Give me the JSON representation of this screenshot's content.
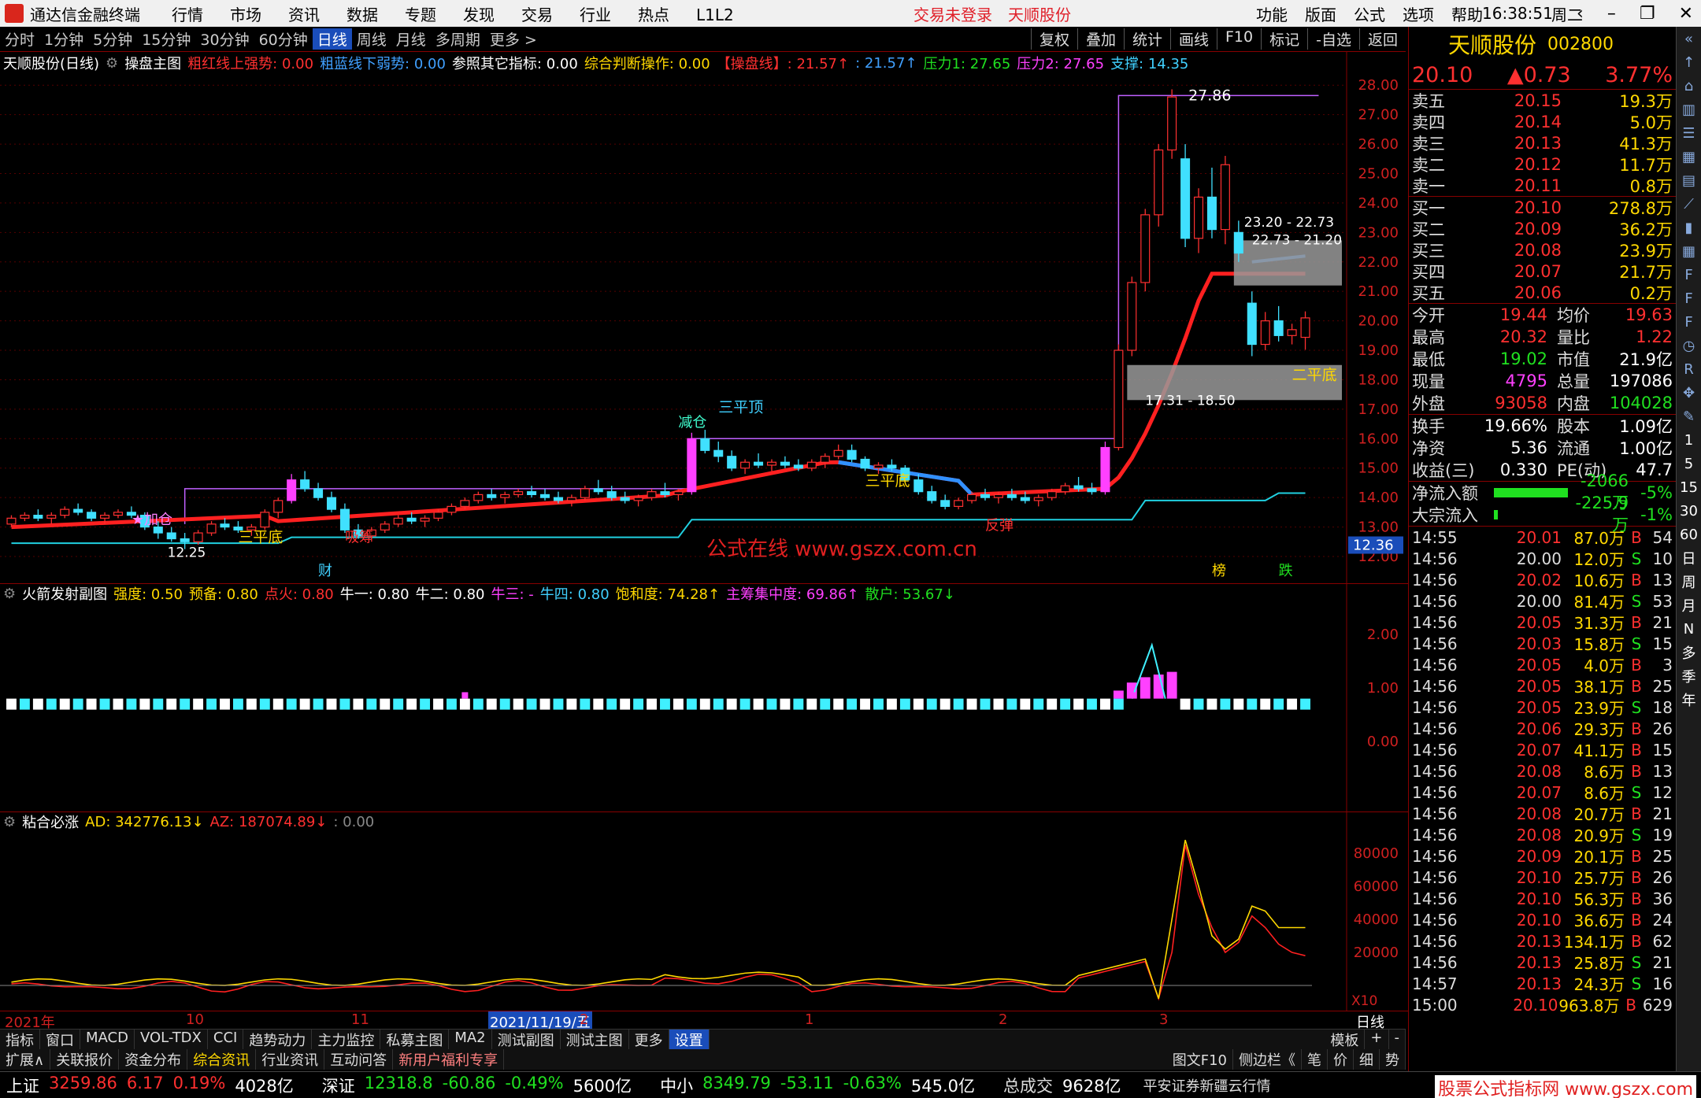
{
  "titlebar": {
    "app_name": "通达信金融终端",
    "menu": [
      "行情",
      "市场",
      "资讯",
      "数据",
      "专题",
      "发现",
      "交易",
      "行业",
      "热点",
      "L1L2"
    ],
    "login_status": "交易未登录",
    "stock_name": "天顺股份",
    "right_menu": [
      "功能",
      "版面",
      "公式",
      "选项",
      "帮助"
    ],
    "clock": "16:38:51",
    "weekday": "周二"
  },
  "periods": [
    "分时",
    "1分钟",
    "5分钟",
    "15分钟",
    "30分钟",
    "60分钟",
    "日线",
    "周线",
    "月线",
    "多周期",
    "更多 >"
  ],
  "active_period": "日线",
  "tools": [
    "复权",
    "叠加",
    "统计",
    "画线",
    "F10",
    "标记",
    "-自选",
    "返回"
  ],
  "main_chart": {
    "stock_label": "天顺股份(日线)",
    "indicator_name": "操盘主图",
    "readouts": [
      {
        "text": "粗红线上强势: 0.00",
        "color": "#ff3030"
      },
      {
        "text": "粗蓝线下弱势: 0.00",
        "color": "#40a0ff"
      },
      {
        "text": "参照其它指标: 0.00",
        "color": "#ffffff"
      },
      {
        "text": "综合判断操作: 0.00",
        "color": "#ffd800"
      },
      {
        "text": "【操盘线】: 21.57↑",
        "color": "#ff3030"
      },
      {
        "text": ": 21.57↑",
        "color": "#40a0ff"
      },
      {
        "text": "压力1: 27.65",
        "color": "#20e020"
      },
      {
        "text": "压力2: 27.65",
        "color": "#ff40ff"
      },
      {
        "text": "支撑: 14.35",
        "color": "#40d0ff"
      }
    ],
    "y_ticks": [
      "28.00",
      "27.00",
      "26.00",
      "25.00",
      "24.00",
      "23.00",
      "22.00",
      "21.00",
      "20.00",
      "19.00",
      "18.00",
      "17.00",
      "16.00",
      "15.00",
      "14.00",
      "13.00",
      "12.00"
    ],
    "current_price_tag": "12.36",
    "annotations": {
      "high": "27.86",
      "zone1": "23.20 - 22.73",
      "zone1b": "22.73 - 21.20",
      "zone2": "17.31 - 18.50",
      "low": "12.25",
      "sanpingding": "三平顶",
      "sanpingdi_1": "三平底",
      "sanpingdi_2": "三平底",
      "sanpingdi_3": "二平底",
      "jiacang": "★加仓",
      "jiancang": "减仓",
      "fantan": "反弹",
      "xichou": "吸筹",
      "watermark": "公式在线  www.gszx.com.cn",
      "cai": "财",
      "bang": "榜",
      "die": "跌"
    }
  },
  "sub1": {
    "name": "火箭发射副图",
    "readouts": [
      {
        "text": "强度: 0.50",
        "color": "#ffd800"
      },
      {
        "text": "预备: 0.80",
        "color": "#ffd800"
      },
      {
        "text": "点火: 0.80",
        "color": "#ff3030"
      },
      {
        "text": "牛一: 0.80",
        "color": "#ffffff"
      },
      {
        "text": "牛二: 0.80",
        "color": "#ffffff"
      },
      {
        "text": "牛三: -",
        "color": "#ff40ff"
      },
      {
        "text": "牛四: 0.80",
        "color": "#40d0ff"
      },
      {
        "text": "饱和度: 74.28↑",
        "color": "#ffd800"
      },
      {
        "text": "主筹集中度: 69.86↑",
        "color": "#ff40ff"
      },
      {
        "text": "散户: 53.67↓",
        "color": "#20e020"
      }
    ],
    "y_ticks": [
      "2.00",
      "1.00",
      "0.00"
    ]
  },
  "sub2": {
    "name": "粘合必涨",
    "readouts": [
      {
        "text": "AD: 342776.13↓",
        "color": "#ffd800"
      },
      {
        "text": "AZ: 187074.89↓",
        "color": "#ff3030"
      },
      {
        "text": ": 0.00",
        "color": "#888888"
      }
    ],
    "y_ticks": [
      "80000",
      "60000",
      "40000",
      "20000"
    ],
    "x10": "X10"
  },
  "x_axis": {
    "labels": [
      "2021年",
      "10",
      "11",
      "2021/11/19/五",
      "2",
      "1",
      "2",
      "3"
    ],
    "right_label": "日线"
  },
  "bottom_tabs": [
    "指标",
    "窗口",
    "MACD",
    "VOL-TDX",
    "CCI",
    "趋势动力",
    "主力监控",
    "私募主图",
    "MA2",
    "测试副图",
    "测试主图",
    "更多",
    "设置"
  ],
  "bottom_right": [
    "模板",
    "+",
    "-"
  ],
  "sub_tabs": [
    "扩展∧",
    "关联报价",
    "资金分布",
    "综合资讯",
    "行业资讯",
    "互动问答",
    "新用户福利专享"
  ],
  "sub_tabs_right": [
    "图文F10",
    "侧边栏《",
    "笔",
    "价",
    "细",
    "势"
  ],
  "status": [
    {
      "name": "上证",
      "value": "3259.86",
      "chg": "6.17",
      "pct": "0.19%",
      "amt": "4028亿",
      "color": "#ff3030"
    },
    {
      "name": "深证",
      "value": "12318.8",
      "chg": "-60.86",
      "pct": "-0.49%",
      "amt": "5600亿",
      "color": "#20e020"
    },
    {
      "name": "中小",
      "value": "8349.79",
      "chg": "-53.11",
      "pct": "-0.63%",
      "amt": "545.0亿",
      "color": "#20e020"
    }
  ],
  "status_total": {
    "label": "总成交",
    "value": "9628亿"
  },
  "status_broker": "平安证券新疆云行情",
  "brand_watermark": "股票公式指标网  www.gszx.com",
  "quote": {
    "name": "天顺股份",
    "code": "002800",
    "price": "20.10",
    "change": "▲0.73",
    "pct": "3.77%",
    "asks": [
      {
        "label": "卖五",
        "price": "20.15",
        "vol": "19.3万"
      },
      {
        "label": "卖四",
        "price": "20.14",
        "vol": "5.0万"
      },
      {
        "label": "卖三",
        "price": "20.13",
        "vol": "41.3万"
      },
      {
        "label": "卖二",
        "price": "20.12",
        "vol": "11.7万"
      },
      {
        "label": "卖一",
        "price": "20.11",
        "vol": "0.8万"
      }
    ],
    "bids": [
      {
        "label": "买一",
        "price": "20.10",
        "vol": "278.8万"
      },
      {
        "label": "买二",
        "price": "20.09",
        "vol": "36.2万"
      },
      {
        "label": "买三",
        "price": "20.08",
        "vol": "23.9万"
      },
      {
        "label": "买四",
        "price": "20.07",
        "vol": "21.7万"
      },
      {
        "label": "买五",
        "price": "20.06",
        "vol": "0.2万"
      }
    ],
    "stats1": [
      {
        "a": "今开",
        "b": "19.44",
        "bc": "#ff3030",
        "c": "均价",
        "d": "19.63",
        "dc": "#ff3030"
      },
      {
        "a": "最高",
        "b": "20.32",
        "bc": "#ff3030",
        "c": "量比",
        "d": "1.22",
        "dc": "#ff3030"
      },
      {
        "a": "最低",
        "b": "19.02",
        "bc": "#20e020",
        "c": "市值",
        "d": "21.9亿",
        "dc": "#ffffff"
      },
      {
        "a": "现量",
        "b": "4795",
        "bc": "#ff40ff",
        "c": "总量",
        "d": "197086",
        "dc": "#ffffff"
      },
      {
        "a": "外盘",
        "b": "93058",
        "bc": "#ff3030",
        "c": "内盘",
        "d": "104028",
        "dc": "#20e020"
      }
    ],
    "stats2": [
      {
        "a": "换手",
        "b": "19.66%",
        "bc": "#ffffff",
        "c": "股本",
        "d": "1.09亿",
        "dc": "#ffffff"
      },
      {
        "a": "净资",
        "b": "5.36",
        "bc": "#ffffff",
        "c": "流通",
        "d": "1.00亿",
        "dc": "#ffffff"
      },
      {
        "a": "收益(三)",
        "b": "0.330",
        "bc": "#ffffff",
        "c": "PE(动)",
        "d": "47.7",
        "dc": "#ffffff"
      }
    ],
    "flows": [
      {
        "label": "净流入额",
        "value": "-2066万",
        "pct": "-5%",
        "bar": 0.9
      },
      {
        "label": "大宗流入",
        "value": "-225.9万",
        "pct": "-1%",
        "bar": 0.05
      }
    ],
    "ticks": [
      [
        "14:55",
        "20.01",
        "87.0万",
        "B",
        "54"
      ],
      [
        "14:56",
        "20.00",
        "12.0万",
        "S",
        "10"
      ],
      [
        "14:56",
        "20.02",
        "10.6万",
        "B",
        "13"
      ],
      [
        "14:56",
        "20.00",
        "81.4万",
        "S",
        "53"
      ],
      [
        "14:56",
        "20.05",
        "31.3万",
        "B",
        "21"
      ],
      [
        "14:56",
        "20.03",
        "15.8万",
        "S",
        "15"
      ],
      [
        "14:56",
        "20.05",
        "4.0万",
        "B",
        "3"
      ],
      [
        "14:56",
        "20.05",
        "38.1万",
        "B",
        "25"
      ],
      [
        "14:56",
        "20.05",
        "23.9万",
        "S",
        "18"
      ],
      [
        "14:56",
        "20.06",
        "29.3万",
        "B",
        "26"
      ],
      [
        "14:56",
        "20.07",
        "41.1万",
        "B",
        "15"
      ],
      [
        "14:56",
        "20.08",
        "8.6万",
        "B",
        "13"
      ],
      [
        "14:56",
        "20.07",
        "8.6万",
        "S",
        "12"
      ],
      [
        "14:56",
        "20.08",
        "20.7万",
        "B",
        "21"
      ],
      [
        "14:56",
        "20.08",
        "20.9万",
        "S",
        "19"
      ],
      [
        "14:56",
        "20.09",
        "20.1万",
        "B",
        "25"
      ],
      [
        "14:56",
        "20.10",
        "25.7万",
        "B",
        "26"
      ],
      [
        "14:56",
        "20.10",
        "56.3万",
        "B",
        "36"
      ],
      [
        "14:56",
        "20.10",
        "36.6万",
        "B",
        "24"
      ],
      [
        "14:56",
        "20.13",
        "134.1万",
        "B",
        "62"
      ],
      [
        "14:56",
        "20.13",
        "25.8万",
        "S",
        "21"
      ],
      [
        "14:57",
        "20.13",
        "24.3万",
        "S",
        "16"
      ],
      [
        "15:00",
        "20.10",
        "963.8万",
        "B",
        "629"
      ]
    ]
  },
  "sidebar_labels": [
    "1",
    "5",
    "15",
    "30",
    "60",
    "日",
    "周",
    "月",
    "N",
    "多",
    "季",
    "年"
  ],
  "colors": {
    "up": "#ff3030",
    "down": "#40d0ff",
    "accent": "#1a4dba",
    "border": "#880000"
  },
  "chart_data": {
    "type": "candlestick",
    "title": "天顺股份(日线)",
    "ylim": [
      12.0,
      28.0
    ],
    "candles": [
      [
        13.1,
        13.4,
        13.0,
        13.3
      ],
      [
        13.3,
        13.5,
        13.2,
        13.4
      ],
      [
        13.4,
        13.6,
        13.2,
        13.3
      ],
      [
        13.3,
        13.5,
        13.1,
        13.4
      ],
      [
        13.4,
        13.7,
        13.3,
        13.6
      ],
      [
        13.6,
        13.8,
        13.4,
        13.5
      ],
      [
        13.5,
        13.6,
        13.2,
        13.3
      ],
      [
        13.3,
        13.5,
        13.1,
        13.4
      ],
      [
        13.4,
        13.6,
        13.3,
        13.5
      ],
      [
        13.5,
        13.7,
        13.3,
        13.4
      ],
      [
        13.4,
        13.5,
        12.9,
        13.0
      ],
      [
        13.0,
        13.2,
        12.6,
        12.8
      ],
      [
        12.8,
        13.0,
        12.5,
        12.6
      ],
      [
        12.6,
        12.8,
        12.25,
        12.5
      ],
      [
        12.5,
        12.9,
        12.4,
        12.8
      ],
      [
        12.8,
        13.2,
        12.7,
        13.1
      ],
      [
        13.1,
        13.3,
        12.9,
        13.0
      ],
      [
        13.0,
        13.2,
        12.8,
        12.9
      ],
      [
        12.9,
        13.1,
        12.7,
        13.0
      ],
      [
        13.0,
        13.6,
        12.9,
        13.5
      ],
      [
        13.5,
        14.0,
        13.3,
        13.9
      ],
      [
        13.9,
        14.8,
        13.8,
        14.6
      ],
      [
        14.6,
        14.9,
        14.2,
        14.3
      ],
      [
        14.3,
        14.5,
        13.9,
        14.0
      ],
      [
        14.0,
        14.2,
        13.5,
        13.6
      ],
      [
        13.6,
        13.8,
        12.8,
        12.9
      ],
      [
        12.9,
        13.1,
        12.6,
        12.7
      ],
      [
        12.7,
        13.0,
        12.5,
        12.9
      ],
      [
        12.9,
        13.2,
        12.8,
        13.1
      ],
      [
        13.1,
        13.4,
        13.0,
        13.3
      ],
      [
        13.3,
        13.5,
        13.1,
        13.2
      ],
      [
        13.2,
        13.4,
        13.0,
        13.3
      ],
      [
        13.3,
        13.6,
        13.2,
        13.5
      ],
      [
        13.5,
        13.8,
        13.4,
        13.7
      ],
      [
        13.7,
        14.0,
        13.6,
        13.9
      ],
      [
        13.9,
        14.2,
        13.8,
        14.1
      ],
      [
        14.1,
        14.3,
        13.9,
        14.0
      ],
      [
        14.0,
        14.2,
        13.8,
        14.1
      ],
      [
        14.1,
        14.3,
        14.0,
        14.2
      ],
      [
        14.2,
        14.4,
        14.0,
        14.1
      ],
      [
        14.1,
        14.3,
        13.9,
        14.0
      ],
      [
        14.0,
        14.2,
        13.8,
        13.9
      ],
      [
        13.9,
        14.1,
        13.7,
        14.0
      ],
      [
        14.0,
        14.4,
        13.9,
        14.3
      ],
      [
        14.3,
        14.6,
        14.1,
        14.2
      ],
      [
        14.2,
        14.4,
        13.9,
        14.0
      ],
      [
        14.0,
        14.2,
        13.8,
        13.9
      ],
      [
        13.9,
        14.1,
        13.7,
        14.0
      ],
      [
        14.0,
        14.3,
        13.9,
        14.2
      ],
      [
        14.2,
        14.5,
        14.0,
        14.1
      ],
      [
        14.1,
        14.3,
        13.9,
        14.2
      ],
      [
        14.2,
        16.2,
        14.1,
        16.0
      ],
      [
        16.0,
        16.3,
        15.5,
        15.6
      ],
      [
        15.6,
        15.9,
        15.2,
        15.4
      ],
      [
        15.4,
        15.6,
        14.9,
        15.0
      ],
      [
        15.0,
        15.3,
        14.8,
        15.2
      ],
      [
        15.2,
        15.5,
        15.0,
        15.1
      ],
      [
        15.1,
        15.3,
        14.9,
        15.2
      ],
      [
        15.2,
        15.4,
        15.0,
        15.1
      ],
      [
        15.1,
        15.3,
        14.9,
        15.0
      ],
      [
        15.0,
        15.3,
        14.9,
        15.2
      ],
      [
        15.2,
        15.5,
        15.0,
        15.4
      ],
      [
        15.4,
        15.8,
        15.3,
        15.6
      ],
      [
        15.6,
        15.8,
        15.2,
        15.3
      ],
      [
        15.3,
        15.4,
        14.9,
        15.0
      ],
      [
        15.0,
        15.2,
        14.8,
        15.1
      ],
      [
        15.1,
        15.3,
        14.9,
        15.0
      ],
      [
        15.0,
        15.1,
        14.5,
        14.6
      ],
      [
        14.6,
        14.8,
        14.1,
        14.2
      ],
      [
        14.2,
        14.4,
        13.8,
        13.9
      ],
      [
        13.9,
        14.1,
        13.6,
        13.7
      ],
      [
        13.7,
        14.0,
        13.6,
        13.9
      ],
      [
        13.9,
        14.2,
        13.8,
        14.1
      ],
      [
        14.1,
        14.3,
        13.9,
        14.0
      ],
      [
        14.0,
        14.2,
        13.8,
        14.1
      ],
      [
        14.1,
        14.3,
        13.9,
        14.0
      ],
      [
        14.0,
        14.2,
        13.8,
        13.9
      ],
      [
        13.9,
        14.1,
        13.7,
        14.0
      ],
      [
        14.0,
        14.3,
        13.9,
        14.2
      ],
      [
        14.2,
        14.5,
        14.1,
        14.4
      ],
      [
        14.4,
        14.7,
        14.2,
        14.3
      ],
      [
        14.3,
        14.5,
        14.1,
        14.2
      ],
      [
        14.2,
        15.9,
        14.1,
        15.7
      ],
      [
        15.7,
        19.2,
        15.6,
        19.0
      ],
      [
        19.0,
        21.5,
        18.8,
        21.3
      ],
      [
        21.3,
        23.8,
        21.0,
        23.6
      ],
      [
        23.6,
        26.0,
        23.2,
        25.8
      ],
      [
        25.8,
        27.86,
        25.5,
        27.6
      ],
      [
        25.5,
        26.0,
        22.5,
        22.8
      ],
      [
        22.8,
        24.5,
        22.3,
        24.2
      ],
      [
        24.2,
        25.2,
        22.8,
        23.1
      ],
      [
        23.1,
        25.6,
        22.6,
        25.3
      ],
      [
        23.0,
        23.4,
        22.0,
        22.3
      ],
      [
        20.6,
        21.0,
        18.8,
        19.2
      ],
      [
        19.2,
        20.3,
        19.0,
        20.0
      ],
      [
        20.0,
        20.5,
        19.3,
        19.5
      ],
      [
        19.5,
        19.9,
        19.2,
        19.7
      ],
      [
        19.44,
        20.32,
        19.02,
        20.1
      ]
    ]
  }
}
